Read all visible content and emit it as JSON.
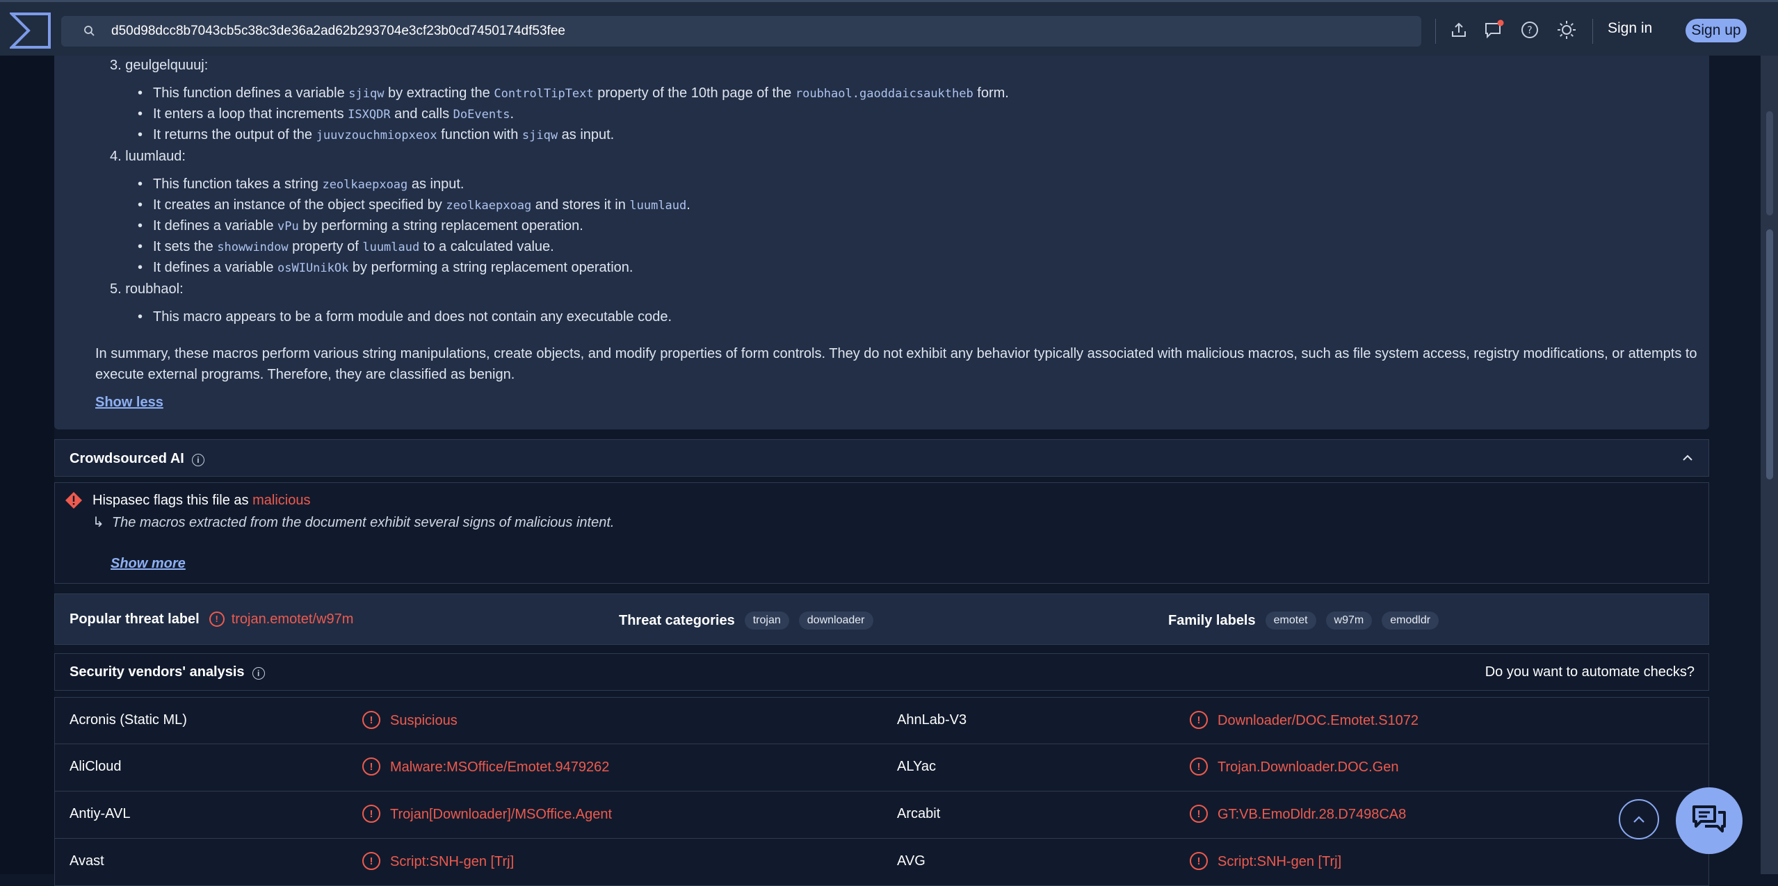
{
  "search": {
    "value": "d50d98dcc8b7043cb5c38c3de36a2ad62b293704e3cf23b0cd7450174df53fee"
  },
  "header": {
    "signin_label": "Sign in",
    "signup_label": "Sign up"
  },
  "analysis": {
    "items": [
      {
        "num": "3.",
        "name": "geulgelquuuj:"
      },
      {
        "num": "4.",
        "name": "luumlaud:"
      },
      {
        "num": "5.",
        "name": "roubhaol:"
      }
    ],
    "b3_1": {
      "a": "This function defines a variable ",
      "c1": "sjiqw",
      "b": " by extracting the ",
      "c2": "ControlTipText",
      "c": " property of the 10th page of the ",
      "c3": "roubhaol.gaoddaicsauktheb",
      "d": " form."
    },
    "b3_2": {
      "a": "It enters a loop that increments ",
      "c1": "ISXQDR",
      "b": " and calls ",
      "c2": "DoEvents",
      "c": "."
    },
    "b3_3": {
      "a": "It returns the output of the ",
      "c1": "juuvzouchmiopxeox",
      "b": " function with ",
      "c2": "sjiqw",
      "c": " as input."
    },
    "b4_1": {
      "a": "This function takes a string ",
      "c1": "zeolkaepxoag",
      "b": " as input."
    },
    "b4_2": {
      "a": "It creates an instance of the object specified by ",
      "c1": "zeolkaepxoag",
      "b": " and stores it in ",
      "c2": "luumlaud",
      "c": "."
    },
    "b4_3": {
      "a": "It defines a variable ",
      "c1": "vPu",
      "b": " by performing a string replacement operation."
    },
    "b4_4": {
      "a": "It sets the ",
      "c1": "showwindow",
      "b": " property of ",
      "c2": "luumlaud",
      "c": " to a calculated value."
    },
    "b4_5": {
      "a": "It defines a variable ",
      "c1": "osWIUnikOk",
      "b": " by performing a string replacement operation."
    },
    "b5_1": "This macro appears to be a form module and does not contain any executable code.",
    "summary": "In summary, these macros perform various string manipulations, create objects, and modify properties of form controls. They do not exhibit any behavior typically associated with malicious macros, such as file system access, registry modifications, or attempts to execute external programs. Therefore, they are classified as benign.",
    "show_less": "Show less"
  },
  "crowd": {
    "title": "Crowdsourced AI",
    "flag_prefix": "Hispasec flags this file as ",
    "flag_verdict": "malicious",
    "reason": "The macros extracted from the document exhibit several signs of malicious intent.",
    "show_more": "Show more"
  },
  "threat": {
    "popular_label": "Popular threat label",
    "popular_value": "trojan.emotet/w97m",
    "categories_label": "Threat categories",
    "categories": [
      "trojan",
      "downloader"
    ],
    "family_label": "Family labels",
    "families": [
      "emotet",
      "w97m",
      "emodldr"
    ]
  },
  "vendors": {
    "title": "Security vendors' analysis",
    "automate": "Do you want to automate checks?",
    "rows": [
      {
        "left_name": "Acronis (Static ML)",
        "left_result": "Suspicious",
        "right_name": "AhnLab-V3",
        "right_result": "Downloader/DOC.Emotet.S1072"
      },
      {
        "left_name": "AliCloud",
        "left_result": "Malware:MSOffice/Emotet.9479262",
        "right_name": "ALYac",
        "right_result": "Trojan.Downloader.DOC.Gen"
      },
      {
        "left_name": "Antiy-AVL",
        "left_result": "Trojan[Downloader]/MSOffice.Agent",
        "right_name": "Arcabit",
        "right_result": "GT:VB.EmoDldr.28.D7498CA8"
      },
      {
        "left_name": "Avast",
        "left_result": "Script:SNH-gen [Trj]",
        "right_name": "AVG",
        "right_result": "Script:SNH-gen [Trj]"
      }
    ]
  },
  "colors": {
    "accent": "#8aa9f3",
    "danger": "#ef5a4e",
    "bg": "#0f1829",
    "panel": "#222f47"
  }
}
